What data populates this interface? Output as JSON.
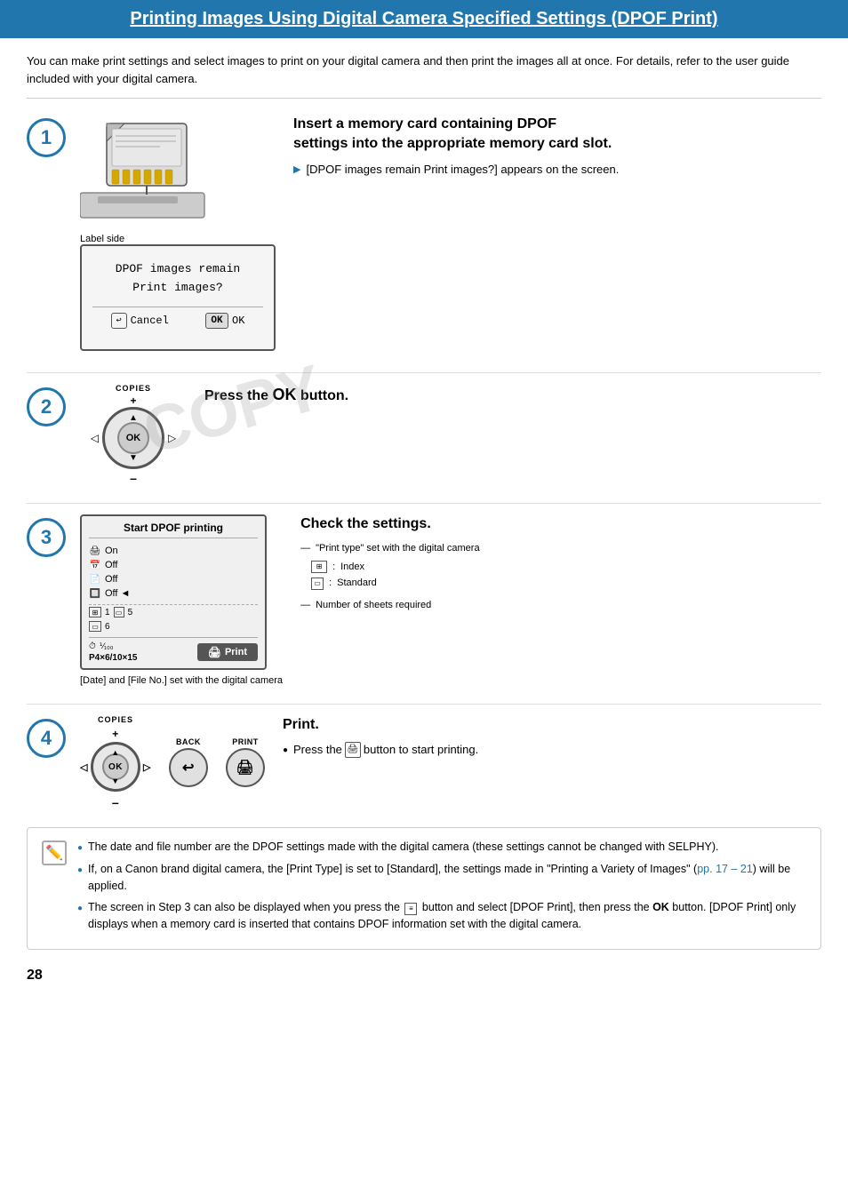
{
  "header": {
    "title": "Printing Images Using Digital Camera Specified Settings (DPOF Print)",
    "title_underlined_words": "Printing Images Using Digital Camera Specified Settings"
  },
  "intro": {
    "text": "You can make print settings and select images to print on your digital camera and then print the images all at once. For details, refer to the user guide included with your digital camera."
  },
  "steps": [
    {
      "number": "1",
      "illustration_label": "Label side",
      "heading_line1": "Insert a memory card containing DPOF",
      "heading_line2": "settings into the appropriate memory card slot.",
      "arrow_text": "[DPOF images remain Print images?] appears on the screen.",
      "dialog": {
        "line1": "DPOF images remain",
        "line2": "Print images?",
        "btn_cancel": "Cancel",
        "btn_ok": "OK"
      }
    },
    {
      "number": "2",
      "heading": "Press the OK button.",
      "copies_label": "COPIES",
      "watermark": "COPY"
    },
    {
      "number": "3",
      "heading": "Check the settings.",
      "screen_title": "Start DPOF printing",
      "rows": [
        {
          "icon": "📷",
          "text": "On"
        },
        {
          "icon": "🔕",
          "text": "Off"
        },
        {
          "icon": "🔕",
          "text": "Off"
        },
        {
          "icon": "🔕",
          "text": "Off ◄"
        }
      ],
      "print_type_label": "\"Print type\" set with the digital camera",
      "index_label": "Index",
      "standard_label": "Standard",
      "sheets_label": "Number of sheets required",
      "paper_size": "P4×6/10×15",
      "print_btn_label": "Print",
      "date_note": "[Date] and [File No.] set with the digital camera",
      "index_num": "1",
      "standard_num": "5",
      "total_num": "6"
    },
    {
      "number": "4",
      "heading": "Print.",
      "copies_label": "COPIES",
      "back_label": "BACK",
      "print_label": "PRINT",
      "bullet_text": "Press the  button to start printing."
    }
  ],
  "notes": [
    {
      "text": "The date and file number are the DPOF settings made with the digital camera (these settings cannot be changed with SELPHY)."
    },
    {
      "text": "If, on a Canon brand digital camera, the [Print Type] is set to [Standard], the settings made in \"Printing a Variety of Images\" (pp. 17 – 21) will be applied.",
      "link_text": "pp. 17 – 21"
    },
    {
      "text": "The screen in Step 3 can also be displayed when you press the  button and select [DPOF Print], then press the OK button. [DPOF Print] only displays when a memory card is inserted that contains DPOF information set with the digital camera."
    }
  ],
  "page_number": "28"
}
